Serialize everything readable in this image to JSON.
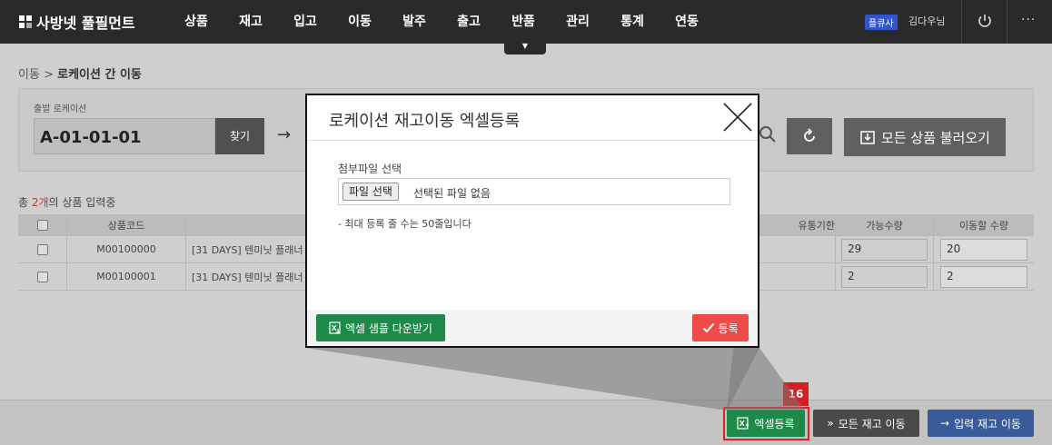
{
  "header": {
    "logo_text": "사방넷 풀필먼트",
    "nav": [
      "상품",
      "재고",
      "입고",
      "이동",
      "발주",
      "출고",
      "반품",
      "관리",
      "통계",
      "연동"
    ],
    "badge": "플큐사",
    "user": "김다우님",
    "more": "···",
    "dropdown_arrow": "▼"
  },
  "breadcrumb": {
    "parent": "이동",
    "separator": ">",
    "current": "로케이션 간 이동"
  },
  "location": {
    "label": "출발 로케이션",
    "value": "A-01-01-01",
    "find_label": "찾기",
    "arrow": "→",
    "load_all_label": "모든 상품 불러오기"
  },
  "count": {
    "prefix": "총 ",
    "num": "2개",
    "suffix": "의 상품 입력중"
  },
  "table": {
    "headers": {
      "code": "상품코드",
      "expiry": "유통기한",
      "avail": "가능수량",
      "qty": "이동할 수량"
    },
    "rows": [
      {
        "code": "M00100000",
        "name": "[31 DAYS] 텐미닛 플래너",
        "avail": "29",
        "qty": "20"
      },
      {
        "code": "M00100001",
        "name": "[31 DAYS] 텐미닛 플래너",
        "avail": "2",
        "qty": "2"
      }
    ]
  },
  "bottom": {
    "excel_label": "엑셀등록",
    "all_move_label": "모든 재고 이동",
    "input_move_label": "입력 재고 이동",
    "step": "16"
  },
  "modal": {
    "title": "로케이션 재고이동 엑셀등록",
    "file_label": "첨부파일 선택",
    "file_button": "파일 선택",
    "file_status": "선택된 파일 없음",
    "note": "- 최대 등록 줄 수는 50줄입니다",
    "sample_label": "엑셀 샘플 다운받기",
    "register_label": "등록"
  }
}
